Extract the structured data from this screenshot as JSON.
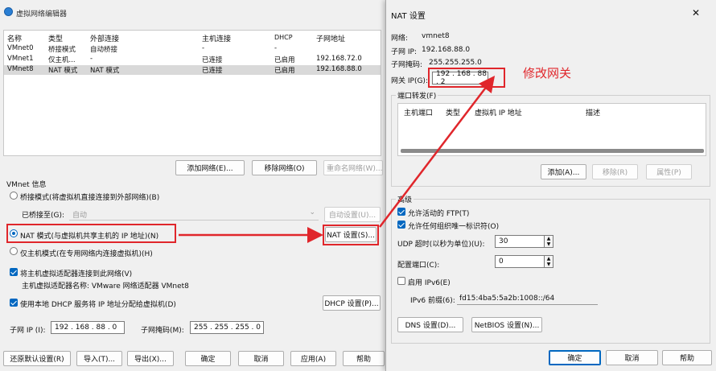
{
  "left": {
    "title": "虚拟网络编辑器",
    "table": {
      "headers": [
        "名称",
        "类型",
        "外部连接",
        "主机连接",
        "DHCP",
        "子网地址"
      ],
      "rows": [
        [
          "VMnet0",
          "桥接模式",
          "自动桥接",
          "-",
          "-",
          ""
        ],
        [
          "VMnet1",
          "仅主机...",
          "-",
          "已连接",
          "已启用",
          "192.168.72.0"
        ],
        [
          "VMnet8",
          "NAT 模式",
          "NAT 模式",
          "已连接",
          "已启用",
          "192.168.88.0"
        ]
      ]
    },
    "buttons": {
      "add_network": "添加网络(E)...",
      "remove_network": "移除网络(O)",
      "rename_network": "重命名网络(W)..."
    },
    "vmnet_info_label": "VMnet 信息",
    "bridged_radio": "桥接模式(将虚拟机直接连接到外部网络)(B)",
    "bridged_to_label": "已桥接至(G):",
    "bridged_to_value": "自动",
    "auto_settings_button": "自动设置(U)...",
    "nat_radio": "NAT 模式(与虚拟机共享主机的 IP 地址)(N)",
    "nat_settings_button": "NAT 设置(S)...",
    "hostonly_radio": "仅主机模式(在专用网络内连接虚拟机)(H)",
    "connect_adapter_check": "将主机虚拟适配器连接到此网络(V)",
    "adapter_name": "主机虚拟适配器名称: VMware 网络适配器 VMnet8",
    "dhcp_check": "使用本地 DHCP 服务将 IP 地址分配给虚拟机(D)",
    "dhcp_settings_button": "DHCP 设置(P)...",
    "subnet_ip_label": "子网 IP (I):",
    "subnet_ip_value": "192 . 168 . 88 . 0",
    "subnet_mask_label": "子网掩码(M):",
    "subnet_mask_value": "255 . 255 . 255 . 0",
    "bottom_buttons": {
      "restore": "还原默认设置(R)",
      "import": "导入(T)...",
      "export": "导出(X)...",
      "ok": "确定",
      "cancel": "取消",
      "apply": "应用(A)",
      "help": "帮助"
    }
  },
  "nat": {
    "title": "NAT 设置",
    "close": "✕",
    "network_label": "网络:",
    "network_value": "vmnet8",
    "subnet_ip_label": "子网 IP:",
    "subnet_ip_value": "192.168.88.0",
    "subnet_mask_label": "子网掩码:",
    "subnet_mask_value": "255.255.255.0",
    "gateway_label": "网关 IP(G):",
    "gateway_value": "192 . 168 . 88 . 2",
    "annotation": "修改网关",
    "port_forward_label": "端口转发(F)",
    "pf_headers": [
      "主机端口",
      "类型",
      "虚拟机 IP 地址",
      "描述"
    ],
    "pf_buttons": {
      "add": "添加(A)...",
      "remove": "移除(R)",
      "props": "属性(P)"
    },
    "advanced_label": "高级",
    "allow_ftp": "允许活动的 FTP(T)",
    "allow_oui": "允许任何组织唯一标识符(O)",
    "udp_label": "UDP 超时(以秒为单位)(U):",
    "udp_value": "30",
    "config_port_label": "配置端口(C):",
    "config_port_value": "0",
    "ipv6_enable": "启用 IPv6(E)",
    "ipv6_prefix_label": "IPv6 前缀(6):",
    "ipv6_prefix_value": "fd15:4ba5:5a2b:1008::/64",
    "dns_button": "DNS 设置(D)...",
    "netbios_button": "NetBIOS 设置(N)...",
    "ok": "确定",
    "cancel": "取消",
    "help": "帮助"
  }
}
